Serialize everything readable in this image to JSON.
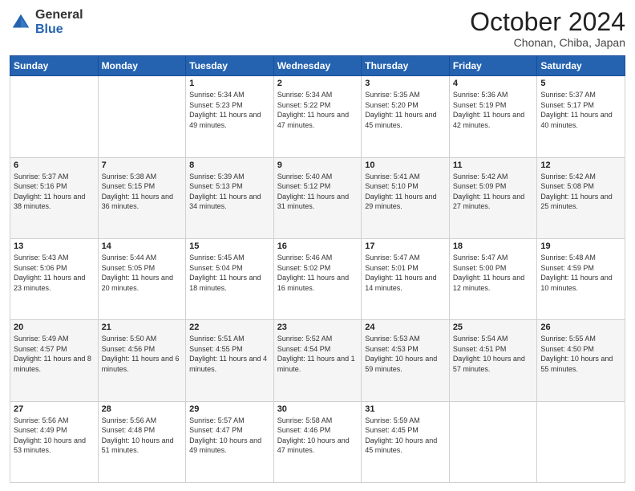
{
  "header": {
    "logo": {
      "general": "General",
      "blue": "Blue"
    },
    "title": "October 2024",
    "location": "Chonan, Chiba, Japan"
  },
  "weekdays": [
    "Sunday",
    "Monday",
    "Tuesday",
    "Wednesday",
    "Thursday",
    "Friday",
    "Saturday"
  ],
  "weeks": [
    [
      {
        "day": "",
        "sunrise": "",
        "sunset": "",
        "daylight": ""
      },
      {
        "day": "",
        "sunrise": "",
        "sunset": "",
        "daylight": ""
      },
      {
        "day": "1",
        "sunrise": "Sunrise: 5:34 AM",
        "sunset": "Sunset: 5:23 PM",
        "daylight": "Daylight: 11 hours and 49 minutes."
      },
      {
        "day": "2",
        "sunrise": "Sunrise: 5:34 AM",
        "sunset": "Sunset: 5:22 PM",
        "daylight": "Daylight: 11 hours and 47 minutes."
      },
      {
        "day": "3",
        "sunrise": "Sunrise: 5:35 AM",
        "sunset": "Sunset: 5:20 PM",
        "daylight": "Daylight: 11 hours and 45 minutes."
      },
      {
        "day": "4",
        "sunrise": "Sunrise: 5:36 AM",
        "sunset": "Sunset: 5:19 PM",
        "daylight": "Daylight: 11 hours and 42 minutes."
      },
      {
        "day": "5",
        "sunrise": "Sunrise: 5:37 AM",
        "sunset": "Sunset: 5:17 PM",
        "daylight": "Daylight: 11 hours and 40 minutes."
      }
    ],
    [
      {
        "day": "6",
        "sunrise": "Sunrise: 5:37 AM",
        "sunset": "Sunset: 5:16 PM",
        "daylight": "Daylight: 11 hours and 38 minutes."
      },
      {
        "day": "7",
        "sunrise": "Sunrise: 5:38 AM",
        "sunset": "Sunset: 5:15 PM",
        "daylight": "Daylight: 11 hours and 36 minutes."
      },
      {
        "day": "8",
        "sunrise": "Sunrise: 5:39 AM",
        "sunset": "Sunset: 5:13 PM",
        "daylight": "Daylight: 11 hours and 34 minutes."
      },
      {
        "day": "9",
        "sunrise": "Sunrise: 5:40 AM",
        "sunset": "Sunset: 5:12 PM",
        "daylight": "Daylight: 11 hours and 31 minutes."
      },
      {
        "day": "10",
        "sunrise": "Sunrise: 5:41 AM",
        "sunset": "Sunset: 5:10 PM",
        "daylight": "Daylight: 11 hours and 29 minutes."
      },
      {
        "day": "11",
        "sunrise": "Sunrise: 5:42 AM",
        "sunset": "Sunset: 5:09 PM",
        "daylight": "Daylight: 11 hours and 27 minutes."
      },
      {
        "day": "12",
        "sunrise": "Sunrise: 5:42 AM",
        "sunset": "Sunset: 5:08 PM",
        "daylight": "Daylight: 11 hours and 25 minutes."
      }
    ],
    [
      {
        "day": "13",
        "sunrise": "Sunrise: 5:43 AM",
        "sunset": "Sunset: 5:06 PM",
        "daylight": "Daylight: 11 hours and 23 minutes."
      },
      {
        "day": "14",
        "sunrise": "Sunrise: 5:44 AM",
        "sunset": "Sunset: 5:05 PM",
        "daylight": "Daylight: 11 hours and 20 minutes."
      },
      {
        "day": "15",
        "sunrise": "Sunrise: 5:45 AM",
        "sunset": "Sunset: 5:04 PM",
        "daylight": "Daylight: 11 hours and 18 minutes."
      },
      {
        "day": "16",
        "sunrise": "Sunrise: 5:46 AM",
        "sunset": "Sunset: 5:02 PM",
        "daylight": "Daylight: 11 hours and 16 minutes."
      },
      {
        "day": "17",
        "sunrise": "Sunrise: 5:47 AM",
        "sunset": "Sunset: 5:01 PM",
        "daylight": "Daylight: 11 hours and 14 minutes."
      },
      {
        "day": "18",
        "sunrise": "Sunrise: 5:47 AM",
        "sunset": "Sunset: 5:00 PM",
        "daylight": "Daylight: 11 hours and 12 minutes."
      },
      {
        "day": "19",
        "sunrise": "Sunrise: 5:48 AM",
        "sunset": "Sunset: 4:59 PM",
        "daylight": "Daylight: 11 hours and 10 minutes."
      }
    ],
    [
      {
        "day": "20",
        "sunrise": "Sunrise: 5:49 AM",
        "sunset": "Sunset: 4:57 PM",
        "daylight": "Daylight: 11 hours and 8 minutes."
      },
      {
        "day": "21",
        "sunrise": "Sunrise: 5:50 AM",
        "sunset": "Sunset: 4:56 PM",
        "daylight": "Daylight: 11 hours and 6 minutes."
      },
      {
        "day": "22",
        "sunrise": "Sunrise: 5:51 AM",
        "sunset": "Sunset: 4:55 PM",
        "daylight": "Daylight: 11 hours and 4 minutes."
      },
      {
        "day": "23",
        "sunrise": "Sunrise: 5:52 AM",
        "sunset": "Sunset: 4:54 PM",
        "daylight": "Daylight: 11 hours and 1 minute."
      },
      {
        "day": "24",
        "sunrise": "Sunrise: 5:53 AM",
        "sunset": "Sunset: 4:53 PM",
        "daylight": "Daylight: 10 hours and 59 minutes."
      },
      {
        "day": "25",
        "sunrise": "Sunrise: 5:54 AM",
        "sunset": "Sunset: 4:51 PM",
        "daylight": "Daylight: 10 hours and 57 minutes."
      },
      {
        "day": "26",
        "sunrise": "Sunrise: 5:55 AM",
        "sunset": "Sunset: 4:50 PM",
        "daylight": "Daylight: 10 hours and 55 minutes."
      }
    ],
    [
      {
        "day": "27",
        "sunrise": "Sunrise: 5:56 AM",
        "sunset": "Sunset: 4:49 PM",
        "daylight": "Daylight: 10 hours and 53 minutes."
      },
      {
        "day": "28",
        "sunrise": "Sunrise: 5:56 AM",
        "sunset": "Sunset: 4:48 PM",
        "daylight": "Daylight: 10 hours and 51 minutes."
      },
      {
        "day": "29",
        "sunrise": "Sunrise: 5:57 AM",
        "sunset": "Sunset: 4:47 PM",
        "daylight": "Daylight: 10 hours and 49 minutes."
      },
      {
        "day": "30",
        "sunrise": "Sunrise: 5:58 AM",
        "sunset": "Sunset: 4:46 PM",
        "daylight": "Daylight: 10 hours and 47 minutes."
      },
      {
        "day": "31",
        "sunrise": "Sunrise: 5:59 AM",
        "sunset": "Sunset: 4:45 PM",
        "daylight": "Daylight: 10 hours and 45 minutes."
      },
      {
        "day": "",
        "sunrise": "",
        "sunset": "",
        "daylight": ""
      },
      {
        "day": "",
        "sunrise": "",
        "sunset": "",
        "daylight": ""
      }
    ]
  ]
}
